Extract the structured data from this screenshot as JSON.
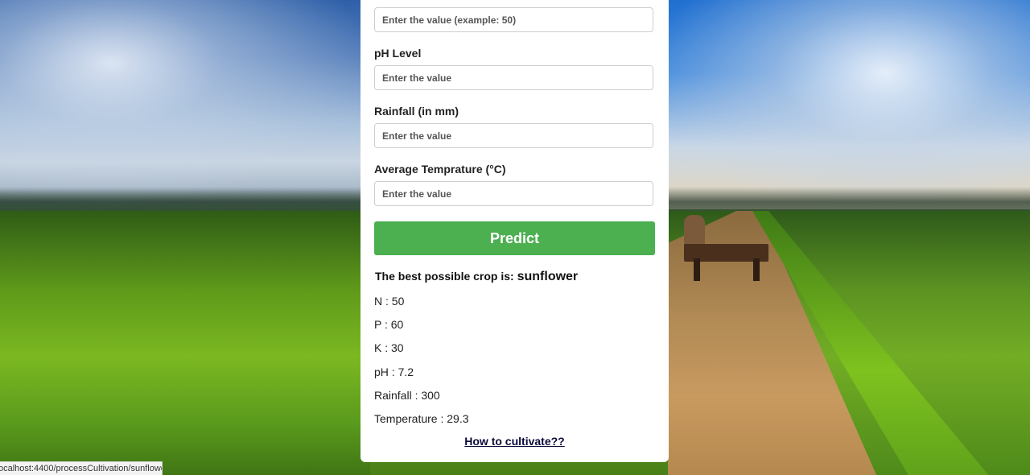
{
  "form": {
    "top_input_placeholder": "Enter the value (example: 50)",
    "ph_label": "pH Level",
    "ph_placeholder": "Enter the value",
    "rainfall_label": "Rainfall (in mm)",
    "rainfall_placeholder": "Enter the value",
    "temperature_label": "Average Temprature (°C)",
    "temperature_placeholder": "Enter the value",
    "predict_label": "Predict"
  },
  "result": {
    "title_prefix": "The best possible crop is:",
    "crop": "sunflower",
    "stats": [
      "N : 50",
      "P : 60",
      "K : 30",
      "pH : 7.2",
      "Rainfall : 300",
      "Temperature : 29.3"
    ],
    "how_link": "How to cultivate??"
  },
  "statusbar": {
    "url": "ocalhost:4400/processCultivation/sunflower"
  },
  "colors": {
    "button": "#4caf50",
    "panel": "#ffffff"
  }
}
